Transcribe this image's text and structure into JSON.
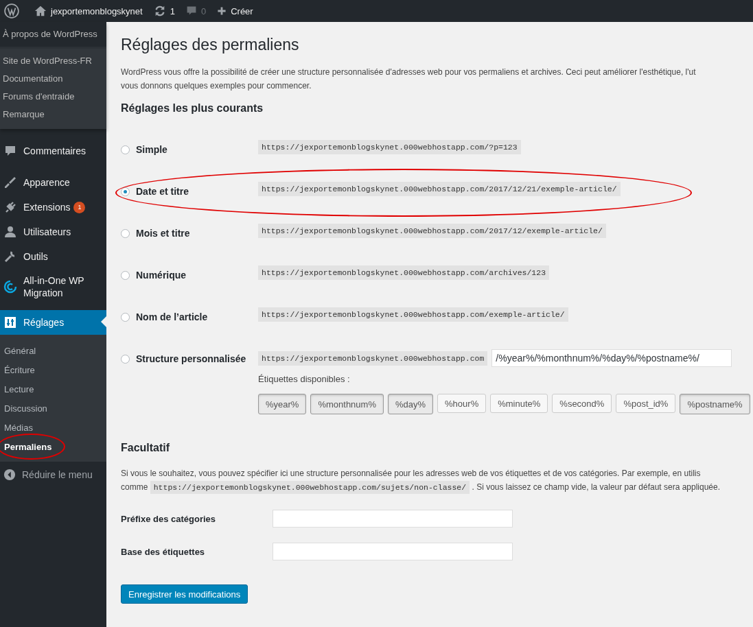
{
  "admin_bar": {
    "site": "jexportemonblogskynet",
    "updates": "1",
    "comments": "0",
    "new": "Créer"
  },
  "flyout": {
    "title": "À propos de WordPress",
    "items": [
      "Site de WordPress-FR",
      "Documentation",
      "Forums d'entraide",
      "Remarque"
    ]
  },
  "menu": [
    {
      "kind": "comment",
      "label": "Commentaires",
      "selected": false
    },
    {
      "kind": "brush",
      "label": "Apparence",
      "selected": false
    },
    {
      "kind": "plug",
      "label": "Extensions",
      "selected": false,
      "badge": "1"
    },
    {
      "kind": "user",
      "label": "Utilisateurs",
      "selected": false
    },
    {
      "kind": "wrench",
      "label": "Outils",
      "selected": false
    },
    {
      "kind": "migration",
      "label": "All-in-One WP Migration",
      "selected": false
    },
    {
      "kind": "settings",
      "label": "Réglages",
      "selected": true,
      "submenu": [
        {
          "label": "Général",
          "selected": false,
          "circled": false
        },
        {
          "label": "Écriture",
          "selected": false,
          "circled": false
        },
        {
          "label": "Lecture",
          "selected": false,
          "circled": false
        },
        {
          "label": "Discussion",
          "selected": false,
          "circled": false
        },
        {
          "label": "Médias",
          "selected": false,
          "circled": false
        },
        {
          "label": "Permaliens",
          "selected": true,
          "circled": true
        }
      ]
    }
  ],
  "collapse": "Réduire le menu",
  "page": {
    "title": "Réglages des permaliens",
    "intro": [
      "WordPress vous offre la possibilité de créer une structure personnalisée d'adresses web pour vos permaliens et archives. Ceci peut améliorer l'esthétique, l'ut",
      "vous donnons quelques exemples pour commencer."
    ],
    "common_heading": "Réglages les plus courants",
    "options": [
      {
        "kind": "preset",
        "label": "Simple",
        "url": "https://jexportemonblogskynet.000webhostapp.com/?p=123",
        "selected": false,
        "circled": false
      },
      {
        "kind": "preset",
        "label": "Date et titre",
        "url": "https://jexportemonblogskynet.000webhostapp.com/2017/12/21/exemple-article/",
        "selected": true,
        "circled": true
      },
      {
        "kind": "preset",
        "label": "Mois et titre",
        "url": "https://jexportemonblogskynet.000webhostapp.com/2017/12/exemple-article/",
        "selected": false,
        "circled": false
      },
      {
        "kind": "preset",
        "label": "Numérique",
        "url": "https://jexportemonblogskynet.000webhostapp.com/archives/123",
        "selected": false,
        "circled": false
      },
      {
        "kind": "preset",
        "label": "Nom de l’article",
        "url": "https://jexportemonblogskynet.000webhostapp.com/exemple-article/",
        "selected": false,
        "circled": false
      },
      {
        "kind": "custom",
        "label": "Structure personnalisée",
        "url": "https://jexportemonblogskynet.000webhostapp.com",
        "value": "/%year%/%monthnum%/%day%/%postname%/",
        "selected": false,
        "circled": false,
        "tags_label": "Étiquettes disponibles :",
        "tags": [
          {
            "label": "%year%",
            "selected": true
          },
          {
            "label": "%monthnum%",
            "selected": true
          },
          {
            "label": "%day%",
            "selected": true
          },
          {
            "label": "%hour%",
            "selected": false
          },
          {
            "label": "%minute%",
            "selected": false
          },
          {
            "label": "%second%",
            "selected": false
          },
          {
            "label": "%post_id%",
            "selected": false
          },
          {
            "label": "%postname%",
            "selected": true
          }
        ]
      }
    ],
    "optional_heading": "Facultatif",
    "optional_text": {
      "before": "Si vous le souhaitez, vous pouvez spécifier ici une structure personnalisée pour les adresses web de vos étiquettes et de vos catégories. Par exemple, en utilis",
      "before_2": "comme",
      "code": "https://jexportemonblogskynet.000webhostapp.com/sujets/non-classe/",
      "after": ". Si vous laissez ce champ vide, la valeur par défaut sera appliquée."
    },
    "fields": [
      {
        "label": "Préfixe des catégories"
      },
      {
        "label": "Base des étiquettes"
      }
    ],
    "save": "Enregistrer les modifications"
  }
}
